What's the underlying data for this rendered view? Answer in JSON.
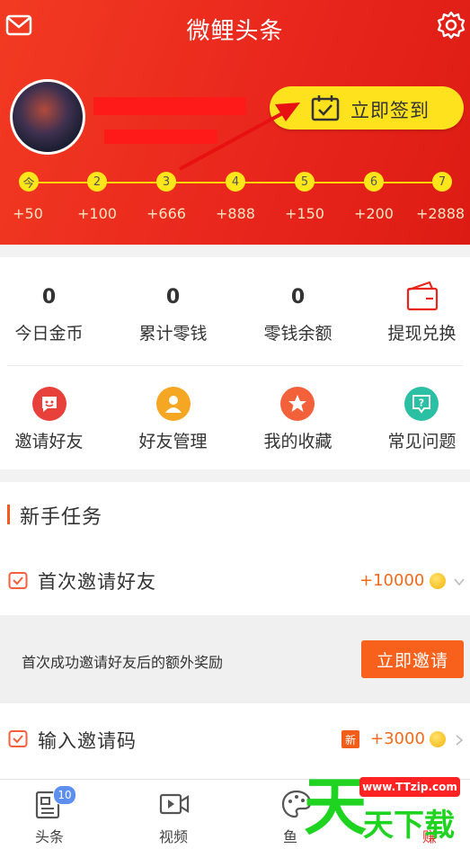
{
  "header": {
    "title": "微鲤头条",
    "sign_button": "立即签到",
    "days": [
      "今",
      "2",
      "3",
      "4",
      "5",
      "6",
      "7"
    ],
    "rewards": [
      "+50",
      "+100",
      "+666",
      "+888",
      "+150",
      "+200",
      "+2888"
    ],
    "colors": {
      "bg": "#e8251c",
      "sign_btn": "#ffe21e",
      "track": "#ffd400"
    }
  },
  "stats": [
    {
      "value": "0",
      "label": "今日金币"
    },
    {
      "value": "0",
      "label": "累计零钱"
    },
    {
      "value": "0",
      "label": "零钱余额"
    },
    {
      "value": "",
      "label": "提现兑换"
    }
  ],
  "shortcuts": [
    {
      "label": "邀请好友",
      "icon": "smile-chat-icon",
      "color": "#e8413b"
    },
    {
      "label": "好友管理",
      "icon": "friend-icon",
      "color": "#f5a623"
    },
    {
      "label": "我的收藏",
      "icon": "star-icon",
      "color": "#f2613a"
    },
    {
      "label": "常见问题",
      "icon": "question-icon",
      "color": "#2bbfa4"
    }
  ],
  "tasks": {
    "section_title": "新手任务",
    "items": [
      {
        "name": "首次邀请好友",
        "points": "+10000",
        "detail": "首次成功邀请好友后的额外奖励",
        "action": "立即邀请"
      },
      {
        "name": "输入邀请码",
        "badge": "新",
        "points": "+3000"
      }
    ]
  },
  "tabbar": {
    "items": [
      {
        "label": "头条",
        "badge": "10"
      },
      {
        "label": "视频"
      },
      {
        "label": "鱼"
      },
      {
        "label": "赚"
      }
    ]
  },
  "watermark": {
    "big": "天",
    "url": "www.TTzip.com",
    "small": "天下载"
  }
}
